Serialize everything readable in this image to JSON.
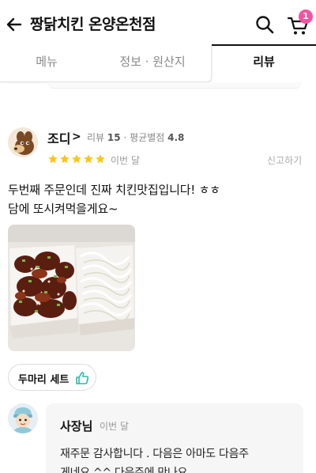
{
  "header": {
    "title": "짱닭치킨 온양온천점",
    "icons": [
      "back-arrow-icon",
      "search-icon",
      "cart-icon"
    ],
    "cart_badge": "1",
    "accent_color": "#f154a0"
  },
  "tabs": [
    {
      "label": "메뉴",
      "active": false
    },
    {
      "label": "정보 · 원산지",
      "active": false
    },
    {
      "label": "리뷰",
      "active": true
    }
  ],
  "review": {
    "name": "조디",
    "chevron": ">",
    "meta_review_label": "리뷰",
    "meta_review_count": "15",
    "meta_separator": "·",
    "meta_avg_label": "평균별점",
    "meta_avg_value": "4.8",
    "rating": 5,
    "star_color": "#fcc419",
    "date": "이번 달",
    "report": "신고하기",
    "text_line1": "두번째 주문인데 진짜 치킨맛집입니다! ㅎㅎ",
    "text_line2": "담에 또시켜먹을게요~",
    "menu_chip": "두마리 세트",
    "menu_chip_icon": "thumbs-up-icon"
  },
  "owner_reply": {
    "name": "사장님",
    "date": "이번 달",
    "text_line1": "재주문 감사합니다 . 다음은 아마도 다음주",
    "text_line2": "게네요 ^^ 다음주에 만나요"
  }
}
